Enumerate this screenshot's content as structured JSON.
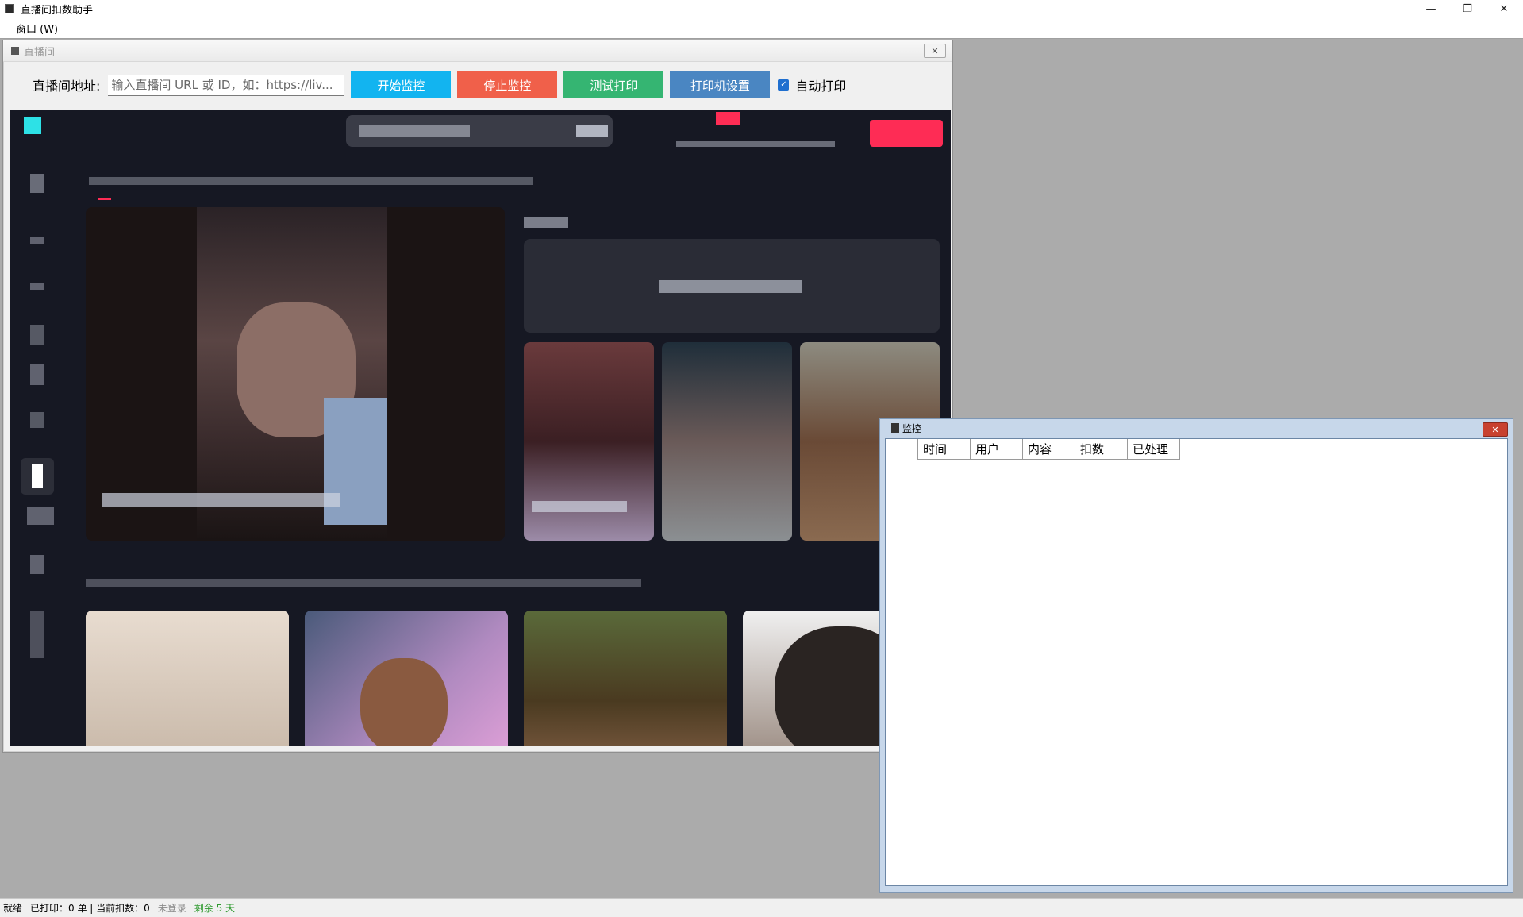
{
  "window": {
    "title": "直播间扣数助手",
    "controls": {
      "minimize": "—",
      "restore": "❐",
      "close": "✕"
    }
  },
  "menubar": {
    "items": [
      {
        "label": "窗口 (W)"
      }
    ]
  },
  "live_window": {
    "title": "直播间",
    "close": "✕",
    "toolbar": {
      "address_label": "直播间地址:",
      "address_placeholder": "输入直播间 URL 或 ID，如：https://liv...",
      "start_button": "开始监控",
      "stop_button": "停止监控",
      "test_print_button": "测试打印",
      "printer_settings_button": "打印机设置",
      "auto_print_label": "自动打印",
      "auto_print_checked": true
    },
    "colors": {
      "start": "#12b4f0",
      "stop": "#f0604a",
      "test": "#35b572",
      "printer": "#4a86c2"
    }
  },
  "monitor_window": {
    "title": "监控",
    "close": "✕",
    "columns": [
      "时间",
      "用户",
      "内容",
      "扣数",
      "已处理"
    ]
  },
  "statusbar": {
    "ready": "就绪",
    "printed": "已打印：0 单 | 当前扣数：0",
    "login": "未登录",
    "remaining": "剩余 5 天"
  }
}
